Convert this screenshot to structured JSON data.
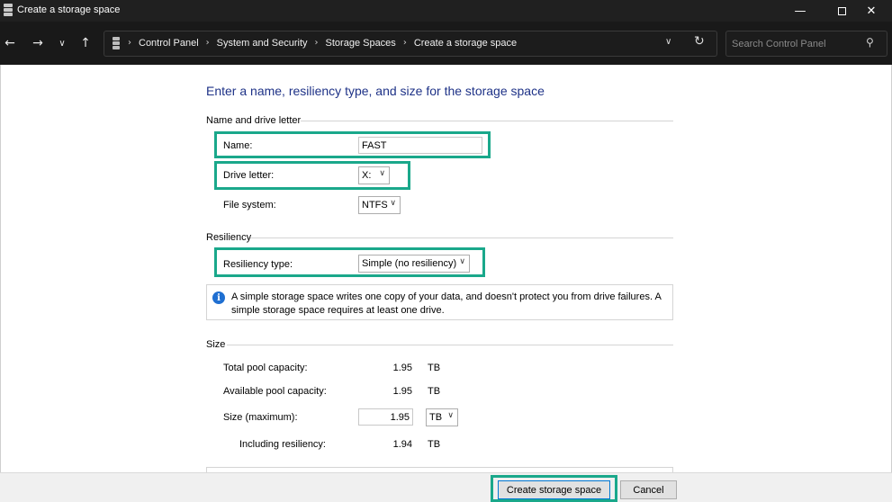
{
  "window": {
    "title": "Create a storage space",
    "minimize_glyph": "—",
    "close_glyph": "✕"
  },
  "nav": {
    "back_glyph": "←",
    "forward_glyph": "→",
    "recent_glyph": "∨",
    "up_glyph": "↑",
    "breadcrumbs": [
      "Control Panel",
      "System and Security",
      "Storage Spaces",
      "Create a storage space"
    ],
    "breadcrumb_sep": "›",
    "dropdown_glyph": "∨",
    "refresh_glyph": "↻",
    "search_placeholder": "Search Control Panel",
    "search_glyph": "⚲"
  },
  "heading": "Enter a name, resiliency type, and size for the storage space",
  "name_section": {
    "label": "Name and drive letter",
    "name_label": "Name:",
    "name_value": "FAST",
    "drive_letter_label": "Drive letter:",
    "drive_letter_value": "X:",
    "file_system_label": "File system:",
    "file_system_value": "NTFS"
  },
  "resiliency_section": {
    "label": "Resiliency",
    "type_label": "Resiliency type:",
    "type_value": "Simple (no resiliency)",
    "info_icon": "i",
    "info_text": "A simple storage space writes one copy of your data, and doesn't protect you from drive failures. A simple storage space requires at least one drive."
  },
  "size_section": {
    "label": "Size",
    "total_label": "Total pool capacity:",
    "total_value": "1.95",
    "total_unit": "TB",
    "available_label": "Available pool capacity:",
    "available_value": "1.95",
    "available_unit": "TB",
    "size_label": "Size (maximum):",
    "size_value": "1.95",
    "size_unit": "TB",
    "including_label": "Including resiliency:",
    "including_value": "1.94",
    "including_unit": "TB"
  },
  "footer": {
    "create_label": "Create storage space",
    "cancel_label": "Cancel"
  },
  "colors": {
    "highlight": "#1aa88b",
    "heading": "#1e3287",
    "info_icon": "#1f6fd1"
  },
  "chevron_glyph": "∨"
}
